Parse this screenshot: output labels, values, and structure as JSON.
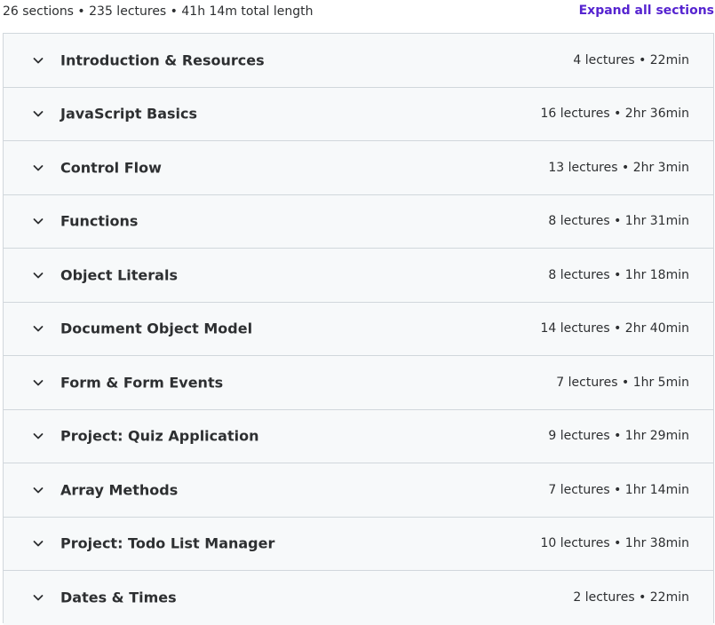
{
  "summary": {
    "text": "26 sections • 235 lectures • 41h 14m total length",
    "expand_label": "Expand all sections"
  },
  "colors": {
    "accent": "#5624d0",
    "text": "#2d2f31",
    "border": "#d1d7dc",
    "section_bg": "#f7f9fa"
  },
  "icons": {
    "section_toggle": "chevron-down-icon"
  },
  "sections": [
    {
      "title": "Introduction & Resources",
      "meta": "4 lectures • 22min"
    },
    {
      "title": "JavaScript Basics",
      "meta": "16 lectures • 2hr 36min"
    },
    {
      "title": "Control Flow",
      "meta": "13 lectures • 2hr 3min"
    },
    {
      "title": "Functions",
      "meta": "8 lectures • 1hr 31min"
    },
    {
      "title": "Object Literals",
      "meta": "8 lectures • 1hr 18min"
    },
    {
      "title": "Document Object Model",
      "meta": "14 lectures • 2hr 40min"
    },
    {
      "title": "Form & Form Events",
      "meta": "7 lectures • 1hr 5min"
    },
    {
      "title": "Project: Quiz Application",
      "meta": "9 lectures • 1hr 29min"
    },
    {
      "title": "Array Methods",
      "meta": "7 lectures • 1hr 14min"
    },
    {
      "title": "Project: Todo List Manager",
      "meta": "10 lectures • 1hr 38min"
    },
    {
      "title": "Dates & Times",
      "meta": "2 lectures • 22min"
    }
  ]
}
